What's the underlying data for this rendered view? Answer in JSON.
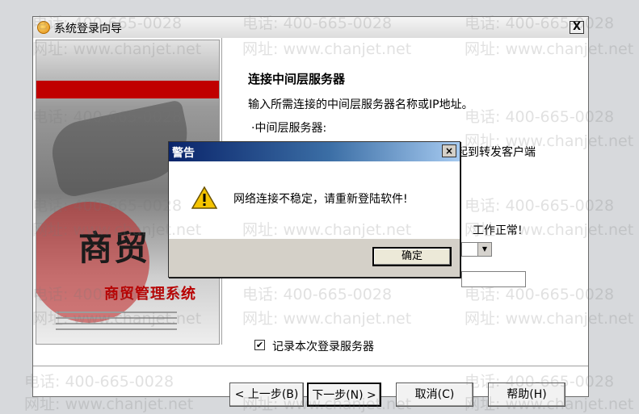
{
  "wizard": {
    "title": "系统登录向导",
    "close_label": "X",
    "art": {
      "title": "商贸",
      "subtitle": "商贸管理系统"
    },
    "heading": "连接中间层服务器",
    "intro": "输入所需连接的中间层服务器名称或IP地址。",
    "bullet": "·中间层服务器:",
    "desc_line1": "连接客户端与数据库的系统纽带，起到转发客户端",
    "desc_line2": "工作正常!",
    "remember_checked": true,
    "remember_label": "记录本次登录服务器",
    "buttons": {
      "prev": "< 上一步(B)",
      "next": "下一步(N) >",
      "cancel": "取消(C)",
      "help": "帮助(H)"
    }
  },
  "alert": {
    "title": "警告",
    "close_label": "×",
    "message": "网络连接不稳定，请重新登陆软件!",
    "ok_label": "确定"
  },
  "watermark": {
    "phone": "电话: 400-665-0028",
    "site": "网址: www.chanjet.net"
  },
  "colors": {
    "accent_red": "#c00000",
    "alert_title_start": "#0a246a",
    "alert_title_end": "#a6caf0"
  }
}
